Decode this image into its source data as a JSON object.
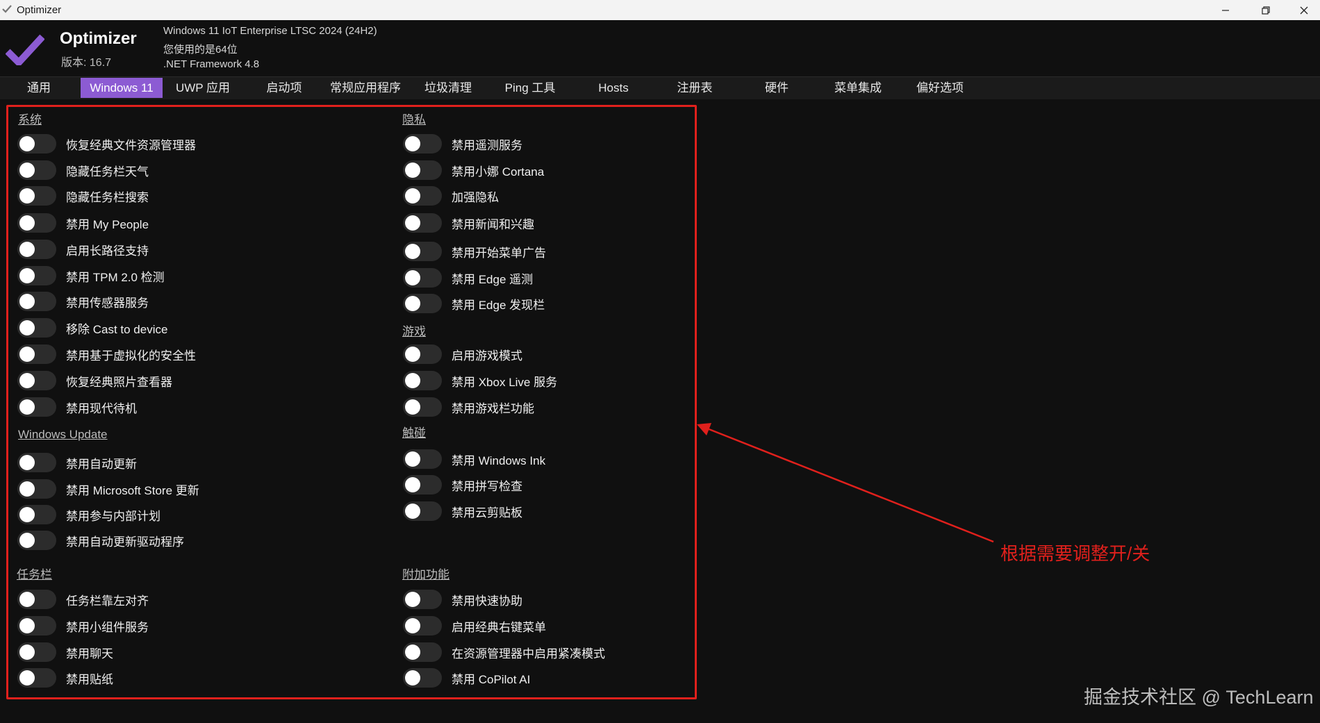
{
  "window": {
    "title": "Optimizer",
    "icons": {
      "app": "checkmark-icon",
      "minimize": "minimize-icon",
      "restore": "restore-icon",
      "close": "close-icon"
    }
  },
  "header": {
    "app_name": "Optimizer",
    "version": "版本: 16.7",
    "os": "Windows 11 IoT Enterprise LTSC 2024 (24H2)",
    "arch": "您使用的是64位",
    "framework": ".NET Framework 4.8",
    "logo_color": "#8c5bd3"
  },
  "tabs": [
    {
      "label": "通用",
      "active": false
    },
    {
      "label": "Windows 11",
      "active": true
    },
    {
      "label": "UWP 应用",
      "active": false
    },
    {
      "label": "启动项",
      "active": false
    },
    {
      "label": "常规应用程序",
      "active": false
    },
    {
      "label": "垃圾清理",
      "active": false
    },
    {
      "label": "Ping 工具",
      "active": false
    },
    {
      "label": "Hosts",
      "active": false
    },
    {
      "label": "注册表",
      "active": false
    },
    {
      "label": "硬件",
      "active": false
    },
    {
      "label": "菜单集成",
      "active": false
    },
    {
      "label": "偏好选项",
      "active": false
    }
  ],
  "sections": {
    "system": {
      "title": "系统",
      "items": [
        {
          "label": "恢复经典文件资源管理器",
          "on": false
        },
        {
          "label": "隐藏任务栏天气",
          "on": false
        },
        {
          "label": "隐藏任务栏搜索",
          "on": false
        },
        {
          "label": "禁用 My People",
          "on": false
        },
        {
          "label": "启用长路径支持",
          "on": false
        },
        {
          "label": "禁用 TPM 2.0 检测",
          "on": false
        },
        {
          "label": "禁用传感器服务",
          "on": false
        },
        {
          "label": "移除 Cast to device",
          "on": false
        },
        {
          "label": "禁用基于虚拟化的安全性",
          "on": false
        },
        {
          "label": "恢复经典照片查看器",
          "on": false
        },
        {
          "label": "禁用现代待机",
          "on": false
        }
      ]
    },
    "windows_update": {
      "title": "Windows Update",
      "items": [
        {
          "label": "禁用自动更新",
          "on": false
        },
        {
          "label": "禁用 Microsoft Store 更新",
          "on": false
        },
        {
          "label": "禁用参与内部计划",
          "on": false
        },
        {
          "label": "禁用自动更新驱动程序",
          "on": false
        }
      ]
    },
    "taskbar": {
      "title": "任务栏",
      "items": [
        {
          "label": "任务栏靠左对齐",
          "on": false
        },
        {
          "label": "禁用小组件服务",
          "on": false
        },
        {
          "label": "禁用聊天",
          "on": false
        },
        {
          "label": "禁用贴纸",
          "on": false
        }
      ]
    },
    "privacy": {
      "title": "隐私",
      "items": [
        {
          "label": "禁用遥测服务",
          "on": false
        },
        {
          "label": "禁用小娜 Cortana",
          "on": false
        },
        {
          "label": "加强隐私",
          "on": false
        },
        {
          "label": "禁用新闻和兴趣",
          "on": false
        },
        {
          "label": "禁用开始菜单广告",
          "on": false
        },
        {
          "label": "禁用 Edge 遥测",
          "on": false
        },
        {
          "label": "禁用 Edge 发现栏",
          "on": false
        }
      ]
    },
    "gaming": {
      "title": "游戏",
      "items": [
        {
          "label": "启用游戏模式",
          "on": false
        },
        {
          "label": "禁用 Xbox Live 服务",
          "on": false
        },
        {
          "label": "禁用游戏栏功能",
          "on": false
        }
      ]
    },
    "touch": {
      "title": "触碰",
      "items": [
        {
          "label": "禁用 Windows Ink",
          "on": false
        },
        {
          "label": "禁用拼写检查",
          "on": false
        },
        {
          "label": "禁用云剪贴板",
          "on": false
        }
      ]
    },
    "extras": {
      "title": "附加功能",
      "items": [
        {
          "label": "禁用快速协助",
          "on": false
        },
        {
          "label": "启用经典右键菜单",
          "on": false
        },
        {
          "label": "在资源管理器中启用紧凑模式",
          "on": false
        },
        {
          "label": "禁用 CoPilot AI",
          "on": false
        }
      ]
    }
  },
  "annotation": {
    "text": "根据需要调整开/关",
    "color": "#e0201c"
  },
  "watermark": "掘金技术社区 @ TechLearn"
}
